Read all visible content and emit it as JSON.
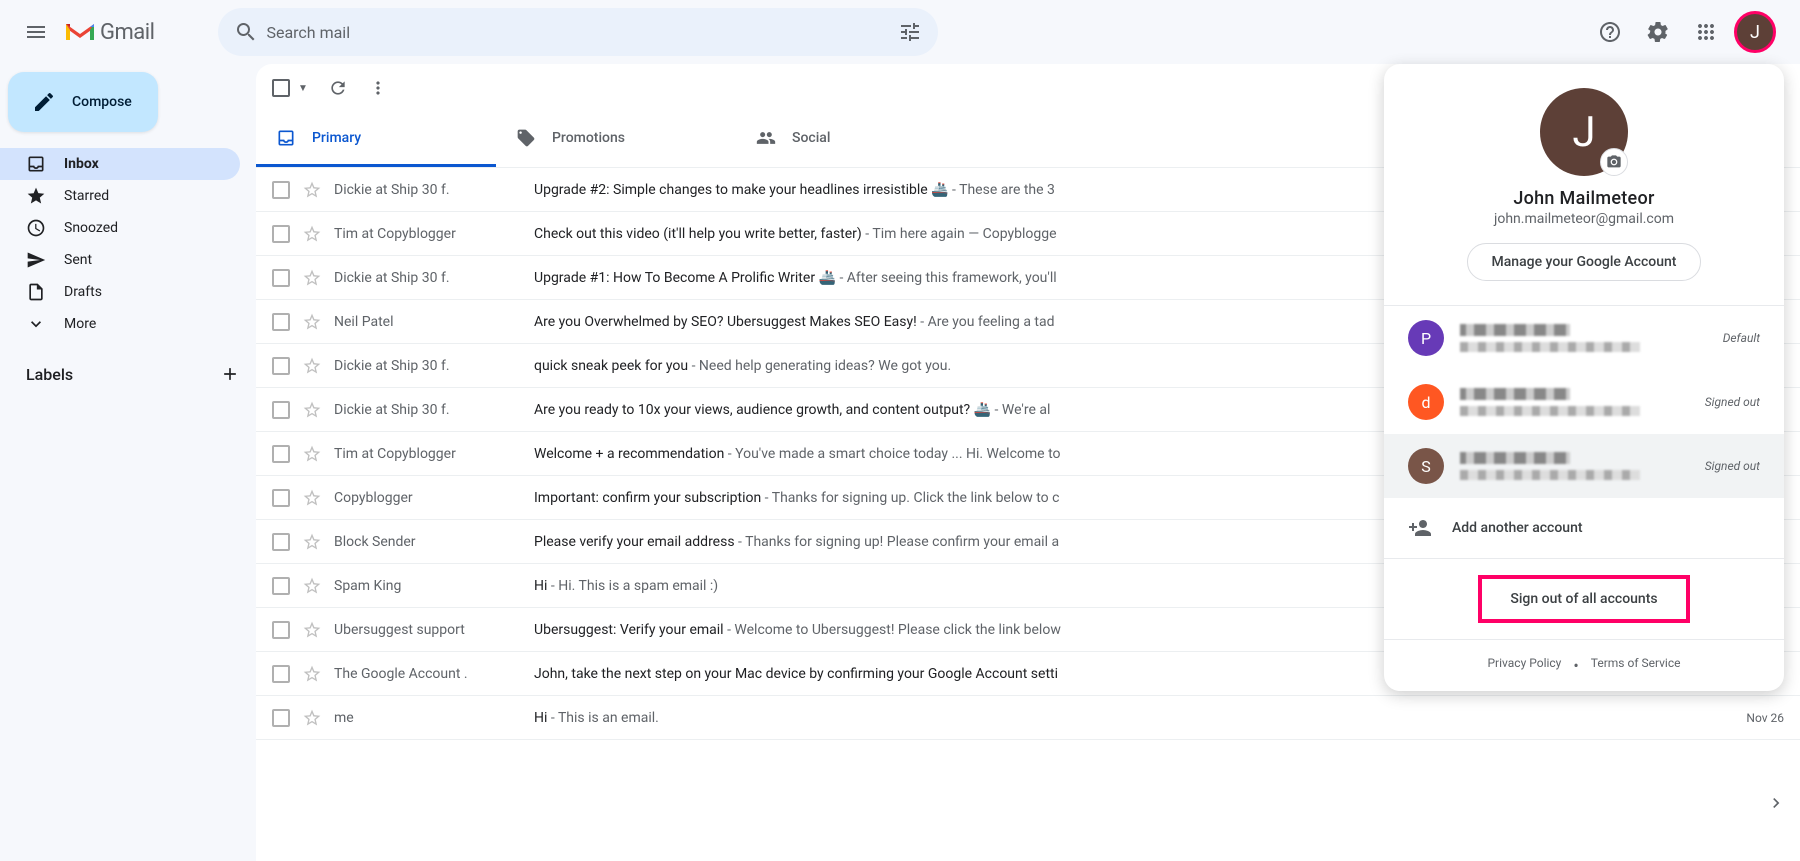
{
  "header": {
    "logo_text": "Gmail",
    "search_placeholder": "Search mail",
    "avatar_initial": "J"
  },
  "sidebar": {
    "compose_label": "Compose",
    "items": [
      {
        "label": "Inbox",
        "active": true,
        "icon": "inbox"
      },
      {
        "label": "Starred",
        "active": false,
        "icon": "star"
      },
      {
        "label": "Snoozed",
        "active": false,
        "icon": "clock"
      },
      {
        "label": "Sent",
        "active": false,
        "icon": "send"
      },
      {
        "label": "Drafts",
        "active": false,
        "icon": "file"
      },
      {
        "label": "More",
        "active": false,
        "icon": "expand"
      }
    ],
    "labels_title": "Labels"
  },
  "tabs": [
    {
      "label": "Primary",
      "active": true,
      "icon": "inbox"
    },
    {
      "label": "Promotions",
      "active": false,
      "icon": "tag"
    },
    {
      "label": "Social",
      "active": false,
      "icon": "people"
    }
  ],
  "emails": [
    {
      "sender": "Dickie at Ship 30 f.",
      "subject": "Upgrade #2: Simple changes to make your headlines irresistible 🚢",
      "snippet": " - These are the 3",
      "date": ""
    },
    {
      "sender": "Tim at Copyblogger",
      "subject": "Check out this video (it'll help you write better, faster)",
      "snippet": " - Tim here again — Copyblogge",
      "date": ""
    },
    {
      "sender": "Dickie at Ship 30 f.",
      "subject": "Upgrade #1: How To Become A Prolific Writer 🚢",
      "snippet": " - After seeing this framework, you'll",
      "date": ""
    },
    {
      "sender": "Neil Patel",
      "subject": "Are you Overwhelmed by SEO? Ubersuggest Makes SEO Easy!",
      "snippet": " - Are you feeling a tad",
      "date": ""
    },
    {
      "sender": "Dickie at Ship 30 f.",
      "subject": "quick sneak peek for you",
      "snippet": " - Need help generating ideas? We got you.",
      "date": ""
    },
    {
      "sender": "Dickie at Ship 30 f.",
      "subject": "Are you ready to 10x your views, audience growth, and content output? 🚢",
      "snippet": " - We're al",
      "date": ""
    },
    {
      "sender": "Tim at Copyblogger",
      "subject": "Welcome + a recommendation",
      "snippet": " - You've made a smart choice today ... Hi. Welcome to",
      "date": ""
    },
    {
      "sender": "Copyblogger",
      "subject": "Important: confirm your subscription",
      "snippet": " - Thanks for signing up. Click the link below to c",
      "date": ""
    },
    {
      "sender": "Block Sender",
      "subject": "Please verify your email address",
      "snippet": " - Thanks for signing up! Please confirm your email a",
      "date": ""
    },
    {
      "sender": "Spam King",
      "subject": "Hi",
      "snippet": " - Hi. This is a spam email :)",
      "date": ""
    },
    {
      "sender": "Ubersuggest support",
      "subject": "Ubersuggest: Verify your email",
      "snippet": " - Welcome to Ubersuggest! Please click the link below",
      "date": ""
    },
    {
      "sender": "The Google Account .",
      "subject": "John, take the next step on your Mac device by confirming your Google Account setti",
      "snippet": "",
      "date": ""
    },
    {
      "sender": "me",
      "subject": "Hi",
      "snippet": " - This is an email.",
      "date": "Nov 26"
    }
  ],
  "popup": {
    "avatar_initial": "J",
    "name": "John Mailmeteor",
    "email": "john.mailmeteor@gmail.com",
    "manage_label": "Manage your Google Account",
    "accounts": [
      {
        "initial": "P",
        "color": "#673ab7",
        "status": "Default",
        "selected": false
      },
      {
        "initial": "d",
        "color": "#ff5722",
        "status": "Signed out",
        "selected": false
      },
      {
        "initial": "S",
        "color": "#795548",
        "status": "Signed out",
        "selected": true
      }
    ],
    "add_account_label": "Add another account",
    "signout_label": "Sign out of all accounts",
    "privacy_label": "Privacy Policy",
    "terms_label": "Terms of Service"
  }
}
